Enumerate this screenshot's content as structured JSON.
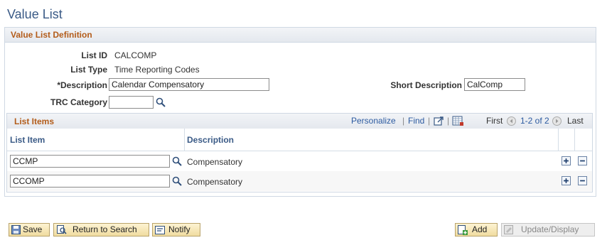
{
  "page": {
    "title": "Value List"
  },
  "definition": {
    "title": "Value List Definition",
    "list_id_label": "List ID",
    "list_id_value": "CALCOMP",
    "list_type_label": "List Type",
    "list_type_value": "Time Reporting Codes",
    "description_label": "*Description",
    "description_value": "Calendar Compensatory",
    "short_desc_label": "Short Description",
    "short_desc_value": "CalComp",
    "trc_category_label": "TRC Category",
    "trc_category_value": ""
  },
  "grid": {
    "title": "List Items",
    "personalize": "Personalize",
    "find": "Find",
    "sep": "|",
    "first": "First",
    "range": "1-2 of 2",
    "last": "Last",
    "columns": {
      "list_item": "List Item",
      "description": "Description"
    },
    "rows": [
      {
        "list_item": "CCMP",
        "description": "Compensatory"
      },
      {
        "list_item": "CCOMP",
        "description": "Compensatory"
      }
    ]
  },
  "toolbar": {
    "save": "Save",
    "return": "Return to Search",
    "notify": "Notify",
    "add": "Add",
    "update": "Update/Display"
  },
  "colors": {
    "title": "#3a5a86",
    "section": "#b35c1a",
    "link": "#2c5aa0"
  }
}
